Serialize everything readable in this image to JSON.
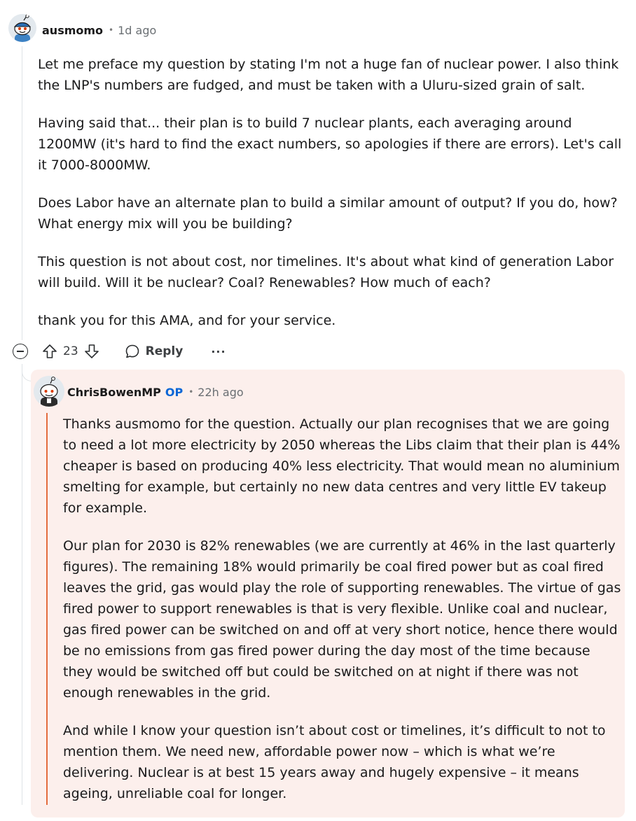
{
  "comment": {
    "username": "ausmomo",
    "separator": "•",
    "time": "1d ago",
    "paragraphs": [
      "Let me preface my question by stating I'm not a huge fan of nuclear power. I also think the LNP's numbers are fudged, and must be taken with a Uluru-sized grain of salt.",
      "Having said that... their plan is to build 7 nuclear plants, each averaging around 1200MW (it's hard to find the exact numbers, so apologies if there are errors). Let's call it 7000-8000MW.",
      "Does Labor have an alternate plan to build a similar amount of output? If you do, how? What energy mix will you be building?",
      "This question is not about cost, nor timelines. It's about what kind of generation Labor will build. Will it be nuclear? Coal? Renewables? How much of each?",
      "thank you for this AMA, and for your service."
    ],
    "votes": "23",
    "reply_label": "Reply",
    "more_label": "···"
  },
  "reply": {
    "username": "ChrisBowenMP",
    "op_badge": "OP",
    "separator": "•",
    "time": "22h ago",
    "paragraphs": [
      "Thanks ausmomo for the question.  Actually our plan recognises that we are going to need a lot more electricity by 2050 whereas the Libs claim that their plan is 44% cheaper is based on producing 40% less electricity.  That would mean no aluminium smelting for example, but certainly no new data centres and very little EV takeup for example.",
      "Our plan for 2030 is 82% renewables (we are currently at 46% in the last quarterly figures).  The remaining 18% would primarily be coal fired power but as coal fired leaves the grid, gas would play the role of supporting renewables.  The virtue of gas fired power to support renewables is that is very flexible.  Unlike coal and nuclear, gas fired power can be switched on and off at very short notice, hence there would be no emissions from gas fired power during the day most of the time because they would be switched off but could be switched on at night if there was not enough renewables in the grid.",
      "And while I know your question isn’t about cost or timelines, it’s difficult to not to mention them. We need new, affordable power now – which is what we’re delivering. Nuclear is at best 15 years away and hugely expensive – it means ageing, unreliable coal for longer."
    ]
  },
  "colors": {
    "op_blue": "#0a66d6",
    "reply_bg": "#fcefec",
    "reply_thread": "#e46c3e"
  }
}
